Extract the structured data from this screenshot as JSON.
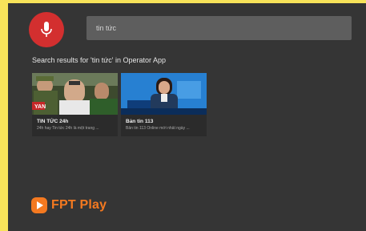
{
  "search": {
    "mic_icon": "microphone-icon",
    "value": "tin tức"
  },
  "results": {
    "heading": "Search results for 'tin tức' in Operator App",
    "cards": [
      {
        "title": "TIN TỨC 24h",
        "description": "24h hay Tin tức 24h là một trang ..."
      },
      {
        "title": "Bản tin 113",
        "description": "Bản tin 113 Online mới nhất ngày ..."
      }
    ]
  },
  "brand": {
    "logo_text": "FPT Play",
    "logo_icon": "play-icon"
  },
  "colors": {
    "frame": "#f8e35a",
    "background": "#353535",
    "mic_button": "#d32f2f",
    "search_box": "#5e5e5e",
    "brand": "#f47920"
  }
}
